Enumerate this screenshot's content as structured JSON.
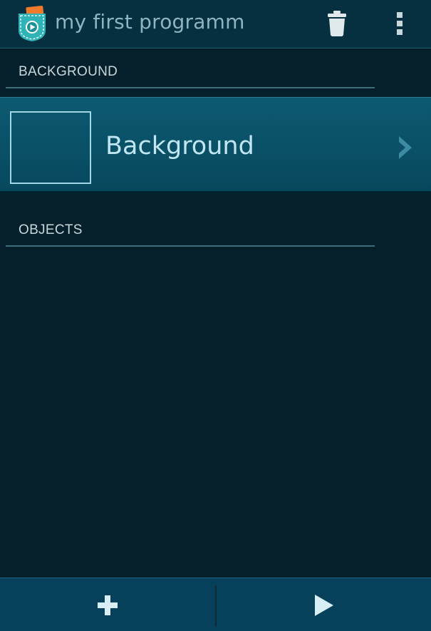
{
  "app": {
    "title": "my first programm",
    "icon": "catroid-pocket-code-icon"
  },
  "toolbar": {
    "delete_icon": "trash-icon",
    "overflow_icon": "overflow-menu-icon"
  },
  "sections": {
    "background": {
      "header": "BACKGROUND"
    },
    "objects": {
      "header": "OBJECTS"
    }
  },
  "background_item": {
    "label": "Background",
    "thumbnail": "empty-thumbnail",
    "chevron_icon": "chevron-right-icon"
  },
  "bottom_bar": {
    "add_icon": "plus-icon",
    "play_icon": "play-icon"
  },
  "colors": {
    "app_background": "#05202a",
    "action_bar": "#06303f",
    "item_background": "#0c5a72",
    "bottom_bar": "#06405a",
    "accent_light": "#9fd7e6"
  }
}
